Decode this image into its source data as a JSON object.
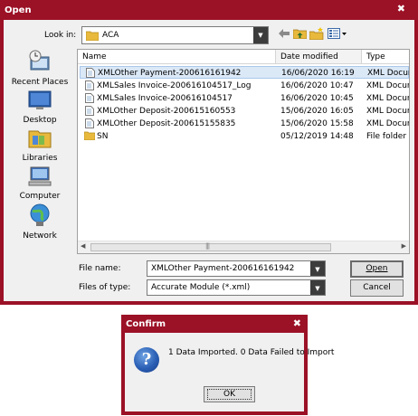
{
  "open_dialog": {
    "title": "Open",
    "close_glyph": "✖",
    "look_in_label": "Look in:",
    "look_in_value": "ACA",
    "toolbar_icons": [
      "back-arrow-icon",
      "up-folder-icon",
      "new-folder-icon",
      "view-menu-icon"
    ],
    "places": [
      {
        "label": "Recent Places",
        "icon": "recent-places-icon"
      },
      {
        "label": "Desktop",
        "icon": "desktop-icon"
      },
      {
        "label": "Libraries",
        "icon": "libraries-icon"
      },
      {
        "label": "Computer",
        "icon": "computer-icon"
      },
      {
        "label": "Network",
        "icon": "network-icon"
      }
    ],
    "columns": [
      "Name",
      "Date modified",
      "Type"
    ],
    "files": [
      {
        "name": "XMLOther Payment-200616161942",
        "date": "16/06/2020 16:19",
        "type": "XML Docum",
        "icon": "xml-file-icon",
        "selected": true
      },
      {
        "name": "XMLSales Invoice-200616104517_Log",
        "date": "16/06/2020 10:47",
        "type": "XML Docum",
        "icon": "xml-file-icon",
        "selected": false
      },
      {
        "name": "XMLSales Invoice-200616104517",
        "date": "16/06/2020 10:45",
        "type": "XML Docum",
        "icon": "xml-file-icon",
        "selected": false
      },
      {
        "name": "XMLOther Deposit-200615160553",
        "date": "15/06/2020 16:05",
        "type": "XML Docum",
        "icon": "xml-file-icon",
        "selected": false
      },
      {
        "name": "XMLOther Deposit-200615155835",
        "date": "15/06/2020 15:58",
        "type": "XML Docum",
        "icon": "xml-file-icon",
        "selected": false
      },
      {
        "name": "SN",
        "date": "05/12/2019 14:48",
        "type": "File folder",
        "icon": "folder-icon",
        "selected": false
      }
    ],
    "file_name_label": "File name:",
    "file_name_value": "XMLOther Payment-200616161942",
    "file_type_label": "Files of type:",
    "file_type_value": "Accurate Module (*.xml)",
    "open_button": "Open",
    "cancel_button": "Cancel"
  },
  "confirm_dialog": {
    "title": "Confirm",
    "close_glyph": "✖",
    "message": "1 Data Imported. 0 Data Failed to Import",
    "ok_button": "OK"
  },
  "colors": {
    "title_bar": "#9b1126",
    "dialog_face": "#f0f0f0",
    "selection": "#dbe8f6"
  }
}
